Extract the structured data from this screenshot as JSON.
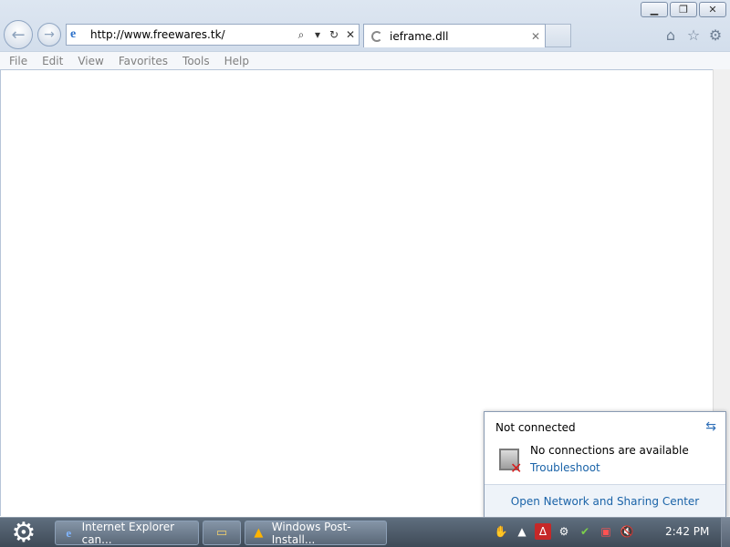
{
  "browser": {
    "address_url": "http://www.freewares.tk/",
    "tab_title": "ieframe.dll",
    "menu": [
      "File",
      "Edit",
      "View",
      "Favorites",
      "Tools",
      "Help"
    ]
  },
  "network_flyout": {
    "status": "Not connected",
    "message": "No connections are available",
    "troubleshoot": "Troubleshoot",
    "footer_link": "Open Network and Sharing Center"
  },
  "taskbar": {
    "buttons": [
      {
        "label": "Internet Explorer can...",
        "icon": "ie-icon"
      },
      {
        "label": "",
        "icon": "folder-icon"
      },
      {
        "label": "Windows Post-Install...",
        "icon": "warning-icon"
      }
    ],
    "tray_icons": [
      "network-monitor-icon",
      "cloud-icon",
      "pdf-icon",
      "gear-icon",
      "shield-icon",
      "network-disconnected-icon",
      "volume-muted-icon"
    ],
    "clock": "2:42 PM"
  },
  "colors": {
    "link": "#1a63a8",
    "error_x": "#d71f1f"
  }
}
